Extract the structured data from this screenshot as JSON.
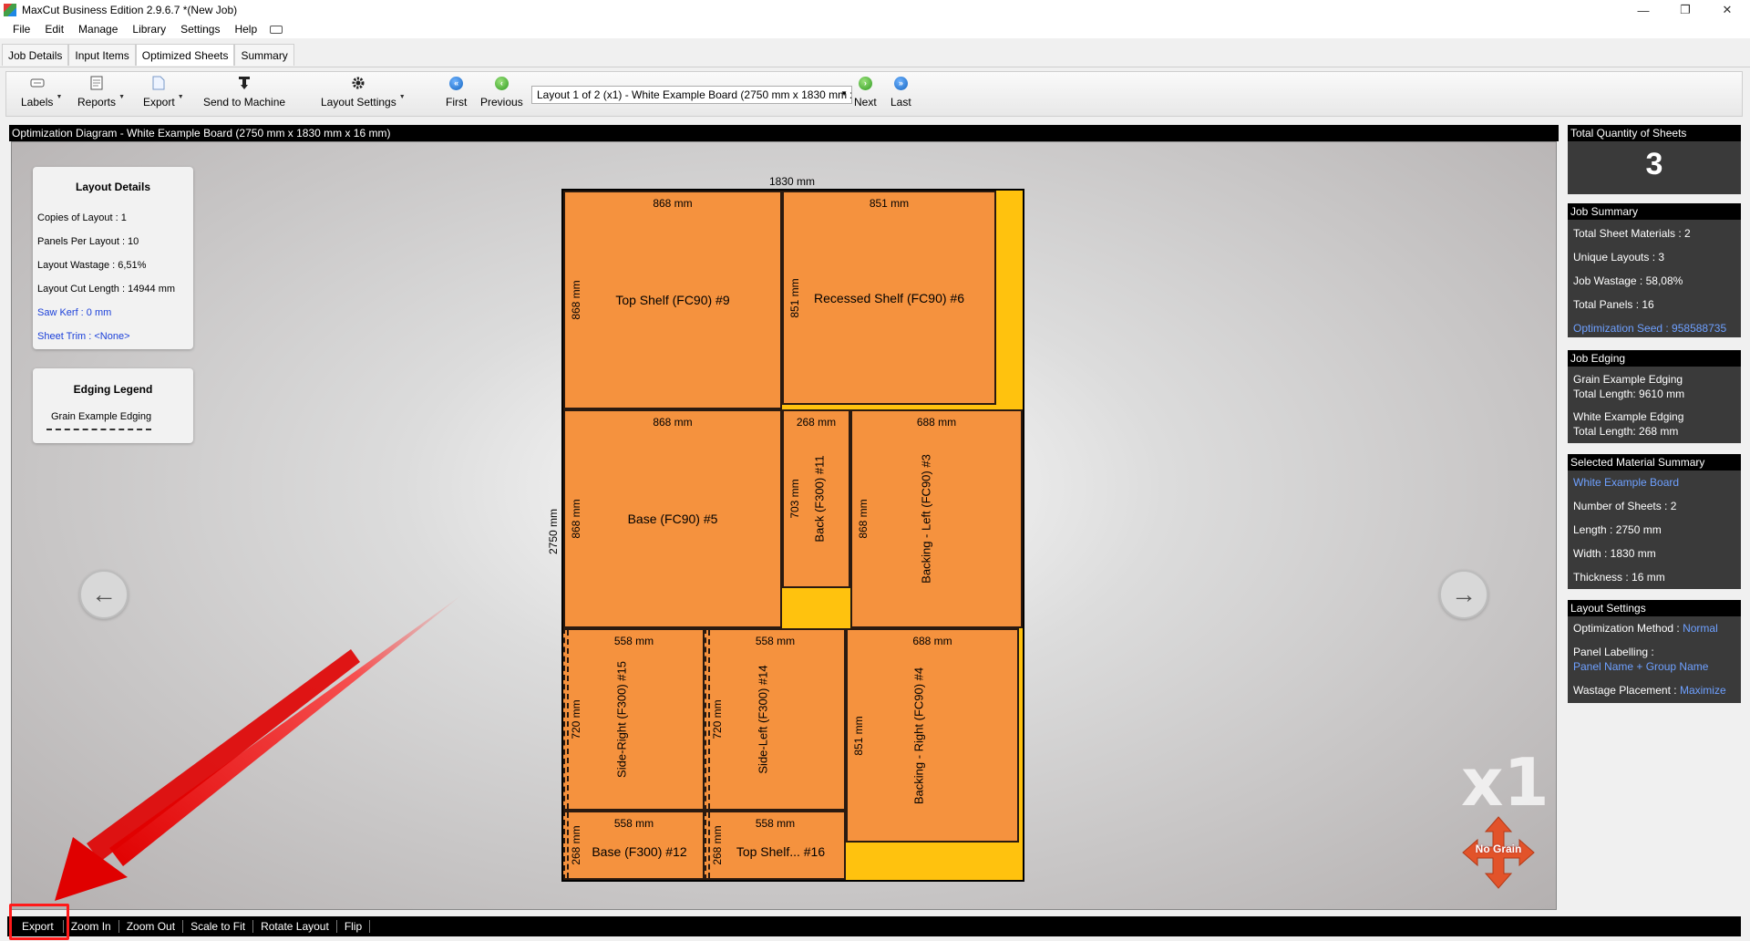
{
  "window": {
    "title": "MaxCut Business Edition 2.9.6.7 *(New Job)"
  },
  "menu": [
    "File",
    "Edit",
    "Manage",
    "Library",
    "Settings",
    "Help"
  ],
  "tabs": [
    {
      "label": "Job Details"
    },
    {
      "label": "Input Items"
    },
    {
      "label": "Optimized Sheets",
      "active": true
    },
    {
      "label": "Summary"
    }
  ],
  "toolbar": {
    "labels": "Labels",
    "reports": "Reports",
    "export": "Export",
    "send_to_machine": "Send to Machine",
    "layout_settings": "Layout Settings",
    "first": "First",
    "previous": "Previous",
    "layout_select": "Layout 1 of 2 (x1) - White Example Board (2750 mm x 1830 mm x 16 mm)",
    "next": "Next",
    "last": "Last"
  },
  "diagram": {
    "header": "Optimization Diagram - White Example Board (2750 mm x 1830 mm x 16 mm)",
    "sheet_width_label": "1830 mm",
    "sheet_length_label": "2750 mm",
    "copies_badge": "x1",
    "grain_badge": "No Grain",
    "panels": [
      {
        "name": "Top Shelf (FC90) #9",
        "w": "868 mm",
        "h": "868 mm"
      },
      {
        "name": "Recessed Shelf (FC90) #6",
        "w": "851 mm",
        "h": "851 mm"
      },
      {
        "name": "Base (FC90) #5",
        "w": "868 mm",
        "h": "868 mm"
      },
      {
        "name": "Back (F300) #11",
        "w": "268 mm",
        "h": "703 mm"
      },
      {
        "name": "Backing - Left (FC90) #3",
        "w": "688 mm",
        "h": "868 mm"
      },
      {
        "name": "Side-Right (F300) #15",
        "w": "558 mm",
        "h": "720 mm"
      },
      {
        "name": "Side-Left (F300) #14",
        "w": "558 mm",
        "h": "720 mm"
      },
      {
        "name": "Backing - Right (FC90) #4",
        "w": "688 mm",
        "h": "851 mm"
      },
      {
        "name": "Base (F300) #12",
        "w": "558 mm",
        "h": "268 mm"
      },
      {
        "name": "Top Shelf... #16",
        "w": "558 mm",
        "h": "268 mm"
      }
    ]
  },
  "layout_details": {
    "title": "Layout Details",
    "copies": "Copies of Layout :  1",
    "panels_per_layout": "Panels Per Layout :  10",
    "wastage": "Layout Wastage :  6,51%",
    "cut_length": "Layout Cut Length :  14944 mm",
    "saw_kerf": "Saw Kerf :  0 mm",
    "sheet_trim": "Sheet Trim :  <None>"
  },
  "edging_legend": {
    "title": "Edging Legend",
    "item": "Grain Example Edging"
  },
  "sidebar": {
    "total_qty_header": "Total Quantity of Sheets",
    "total_qty": "3",
    "job_summary_header": "Job Summary",
    "total_sheet_materials": "Total Sheet Materials :  2",
    "unique_layouts": "Unique Layouts :  3",
    "job_wastage": "Job Wastage :  58,08%",
    "total_panels": "Total Panels :  16",
    "optimization_seed": "Optimization Seed :  958588735",
    "job_edging_header": "Job Edging",
    "edging1_name": "Grain Example Edging",
    "edging1_len": "Total Length: 9610 mm",
    "edging2_name": "White Example Edging",
    "edging2_len": "Total Length: 268 mm",
    "material_header": "Selected Material Summary",
    "material_name": "White Example Board",
    "num_sheets": "Number of Sheets :  2",
    "length": "Length :  2750 mm",
    "width": "Width :  1830 mm",
    "thickness": "Thickness :  16 mm",
    "layout_settings_header": "Layout Settings",
    "opt_method_label": "Optimization Method :",
    "opt_method_value": "Normal",
    "panel_labelling_label": "Panel Labelling :",
    "panel_labelling_value": "Panel Name + Group Name",
    "wastage_placement_label": "Wastage Placement :",
    "wastage_placement_value": "Maximize"
  },
  "bottombar": [
    "Export",
    "Zoom In",
    "Zoom Out",
    "Scale to Fit",
    "Rotate Layout",
    "Flip"
  ],
  "colors": {
    "panel": "#f5923e",
    "waste": "#ffc20e",
    "highlight": "#ff1a1a",
    "link": "#1a3fd9"
  }
}
